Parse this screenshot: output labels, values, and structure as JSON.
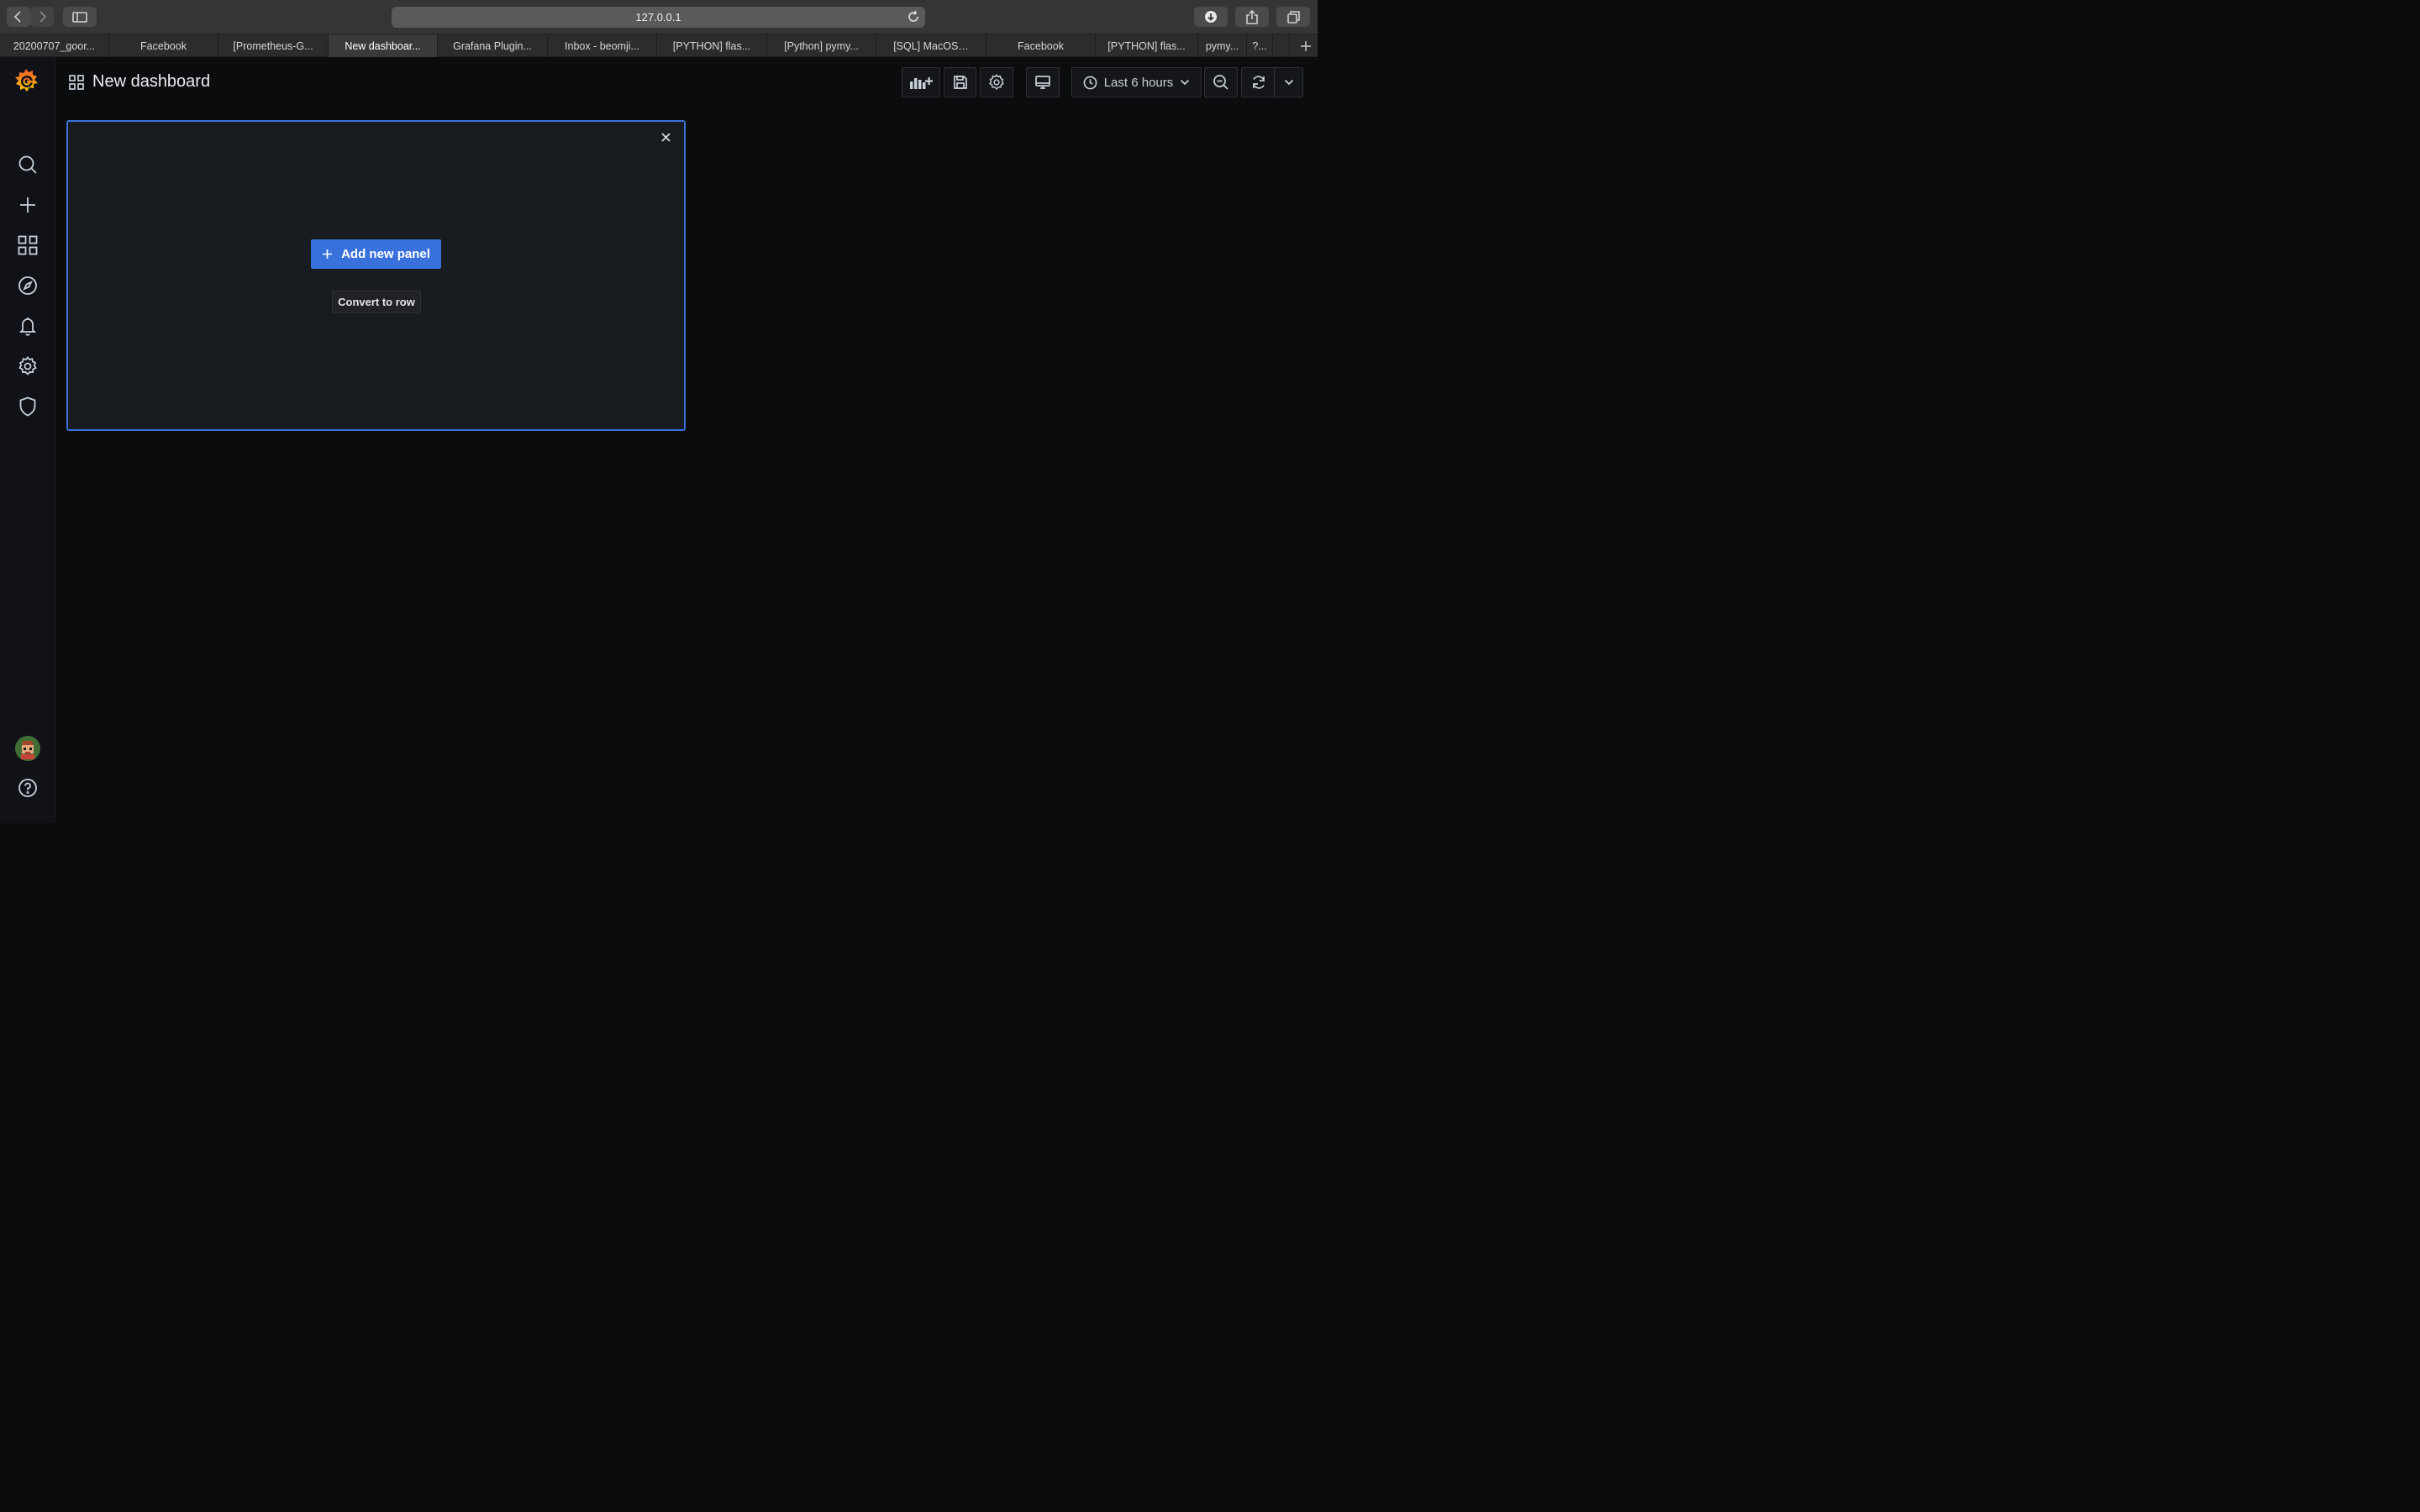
{
  "browser": {
    "url": "127.0.0.1",
    "tabs": [
      {
        "label": "20200707_goor..."
      },
      {
        "label": "Facebook"
      },
      {
        "label": "[Prometheus-G..."
      },
      {
        "label": "New dashboar...",
        "active": true
      },
      {
        "label": "Grafana Plugin..."
      },
      {
        "label": "Inbox - beomji..."
      },
      {
        "label": "[PYTHON] flas..."
      },
      {
        "label": "[Python] pymy..."
      },
      {
        "label": "[SQL] MacOS…"
      },
      {
        "label": "Facebook"
      },
      {
        "label": "[PYTHON] flas..."
      },
      {
        "label": "pymy..."
      },
      {
        "label": "?..."
      },
      {
        "label": ""
      }
    ],
    "icons": [
      "back-icon",
      "forward-icon",
      "sidebar-toggle-icon",
      "reload-icon",
      "download-icon",
      "share-icon",
      "tabs-overview-icon",
      "new-tab-icon"
    ]
  },
  "sidebar": {
    "items": [
      "grafana-logo",
      "search-icon",
      "plus-icon",
      "dashboards-icon",
      "explore-icon",
      "alerting-icon",
      "configuration-icon",
      "shield-icon",
      "avatar",
      "help-icon"
    ]
  },
  "header": {
    "title": "New dashboard",
    "time_range": "Last 6 hours"
  },
  "panel": {
    "add_label": "Add new panel",
    "convert_label": "Convert to row"
  },
  "colors": {
    "accent": "#3871dc",
    "panel_border": "#3d71d9",
    "grafana_orange": "#f15a24"
  }
}
